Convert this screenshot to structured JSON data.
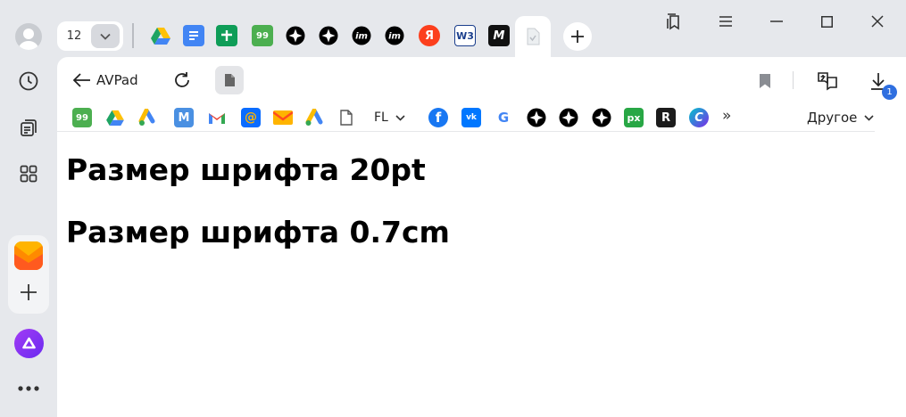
{
  "tabs": {
    "count": "12",
    "items": [
      {
        "name": "google-drive",
        "color": "#1fa463"
      },
      {
        "name": "google-docs",
        "color": "#4285f4"
      },
      {
        "name": "google-sheets",
        "color": "#0f9d58"
      },
      {
        "name": "99-plus",
        "color": "#4caf50",
        "text": "99"
      },
      {
        "name": "compass",
        "color": "#000000"
      },
      {
        "name": "compass",
        "color": "#000000"
      },
      {
        "name": "im",
        "color": "#000000",
        "text": "im"
      },
      {
        "name": "im",
        "color": "#000000",
        "text": "im"
      },
      {
        "name": "yandex",
        "color": "#fc3f1d",
        "text": "Я"
      },
      {
        "name": "w3schools",
        "color": "#04aa6d",
        "text": "W3"
      },
      {
        "name": "m-logo",
        "color": "#111111",
        "text": "M"
      },
      {
        "name": "avpad",
        "color": "#e9e9e9"
      }
    ]
  },
  "toolbar": {
    "back_label": "AVPad",
    "downloads_badge": "1"
  },
  "bookmarks": {
    "items": [
      {
        "name": "99-plus",
        "color": "#4caf50",
        "text": "99"
      },
      {
        "name": "google-drive",
        "color": "#1fa463"
      },
      {
        "name": "google-ads",
        "color": "#fbbc04"
      },
      {
        "name": "medium",
        "color": "#4a90e2",
        "text": "M"
      },
      {
        "name": "gmail",
        "color": "#ea4335",
        "text": "M"
      },
      {
        "name": "mail-ru",
        "color": "#0a6cff",
        "text": "@"
      },
      {
        "name": "yandex-mail",
        "color": "#ffb400"
      },
      {
        "name": "google-ads",
        "color": "#4285f4"
      },
      {
        "name": "document",
        "color": "#888888"
      }
    ],
    "folder_label": "FL",
    "items2": [
      {
        "name": "facebook",
        "color": "#1877f2",
        "text": "f"
      },
      {
        "name": "vk",
        "color": "#0077ff",
        "text": "vk"
      },
      {
        "name": "google",
        "color": "#ffffff",
        "text": "G"
      },
      {
        "name": "compass",
        "color": "#000000"
      },
      {
        "name": "compass",
        "color": "#000000"
      },
      {
        "name": "compass",
        "color": "#000000"
      },
      {
        "name": "px",
        "color": "#28a745",
        "text": "px"
      },
      {
        "name": "r-logo",
        "color": "#1c1c1c",
        "text": "R"
      },
      {
        "name": "canva",
        "color": "#00c4cc",
        "text": "C"
      }
    ],
    "more_label": "»",
    "other_label": "Другое"
  },
  "content": {
    "heading1": "Размер шрифта 20pt",
    "heading2": "Размер шрифта 0.7cm"
  }
}
